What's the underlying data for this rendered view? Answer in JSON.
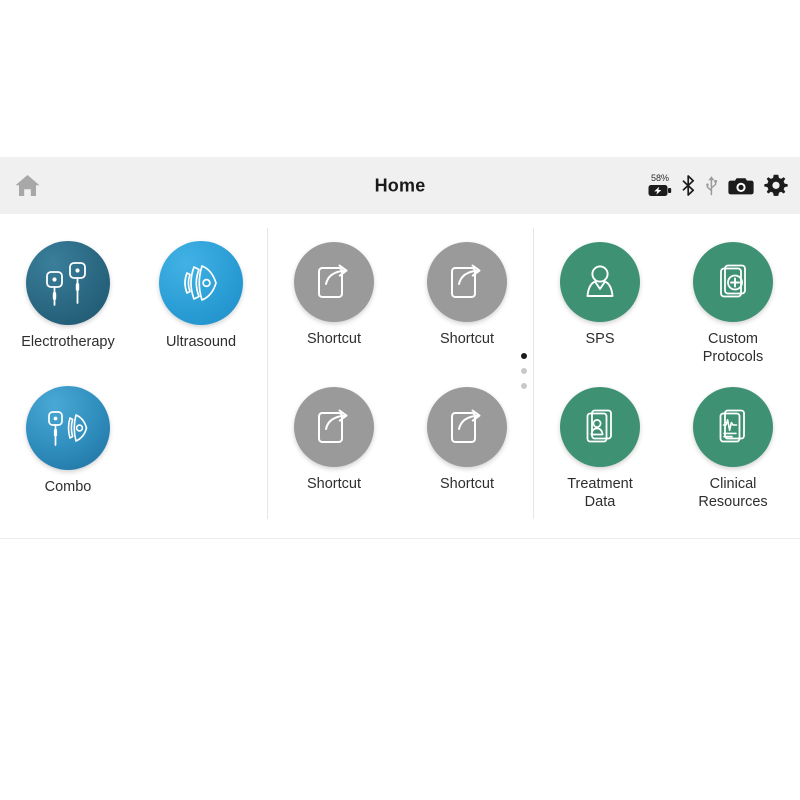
{
  "header": {
    "title": "Home",
    "home_icon": "home-icon",
    "status": {
      "battery_percent": "58%",
      "battery_icon": "battery-charging-icon",
      "bluetooth_icon": "bluetooth-icon",
      "usb_icon": "usb-icon",
      "camera_icon": "camera-icon",
      "settings_icon": "gear-icon"
    }
  },
  "colors": {
    "header_bg": "#f0f0f0",
    "electrotherapy_start": "#2c6b86",
    "electrotherapy_end": "#1d566e",
    "ultrasound_start": "#35a8dd",
    "ultrasound_end": "#1e93cf",
    "combo_start": "#3e9ccb",
    "combo_end": "#1f6f9e",
    "shortcut": "#9a9a9a",
    "green": "#3f9174",
    "dot_active": "#1c1c1c",
    "dot_inactive": "#c9c9c9",
    "label_text": "#2e2e2e"
  },
  "tiles": {
    "modalities": [
      {
        "label": "Electrotherapy",
        "icon": "electrode-pads-icon",
        "color": "electrotherapy"
      },
      {
        "label": "Ultrasound",
        "icon": "ultrasound-waves-icon",
        "color": "ultrasound"
      },
      {
        "label": "Combo",
        "icon": "combo-electrode-ultrasound-icon",
        "color": "combo"
      }
    ],
    "shortcuts": [
      {
        "label": "Shortcut",
        "icon": "shortcut-arrow-icon"
      },
      {
        "label": "Shortcut",
        "icon": "shortcut-arrow-icon"
      },
      {
        "label": "Shortcut",
        "icon": "shortcut-arrow-icon"
      },
      {
        "label": "Shortcut",
        "icon": "shortcut-arrow-icon"
      }
    ],
    "tools": [
      {
        "label": "SPS",
        "icon": "person-icon"
      },
      {
        "label": "Custom\nProtocols",
        "icon": "cards-plus-icon"
      },
      {
        "label": "Treatment\nData",
        "icon": "cards-person-icon"
      },
      {
        "label": "Clinical\nResources",
        "icon": "cards-waveform-icon"
      }
    ]
  },
  "pager": {
    "total": 3,
    "active_index": 0
  }
}
